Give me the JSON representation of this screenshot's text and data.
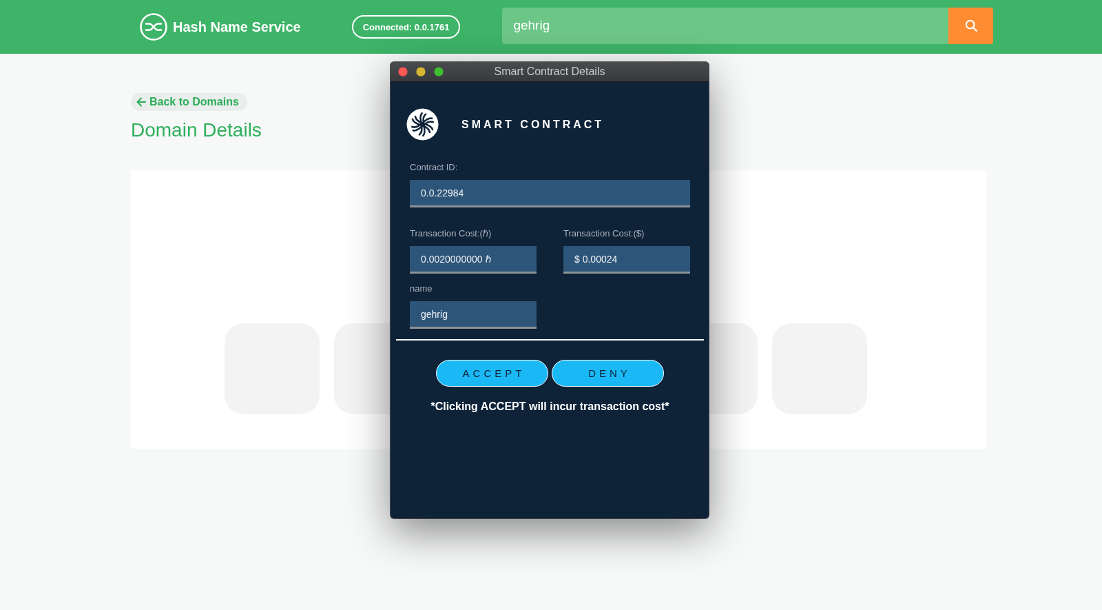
{
  "header": {
    "title": "Hash Name Service",
    "connection": "Connected: 0.0.1761",
    "search": {
      "value": "gehrig"
    }
  },
  "page": {
    "back_link": "Back to Domains",
    "title": "Domain Details"
  },
  "dialog": {
    "window_title": "Smart Contract Details",
    "heading": "SMART CONTRACT",
    "contract_id": {
      "label": "Contract ID:",
      "value": "0.0.22984"
    },
    "fields": [
      {
        "label": "Transaction Cost:(ℏ)",
        "value": "0.0020000000 ℏ"
      },
      {
        "label": "Transaction Cost:($)",
        "value": "$ 0.00024"
      },
      {
        "label": "name",
        "value": "gehrig"
      }
    ],
    "buttons": [
      "ACCEPT",
      "DENY"
    ],
    "note": "*Clicking ACCEPT will incur transaction cost*"
  }
}
